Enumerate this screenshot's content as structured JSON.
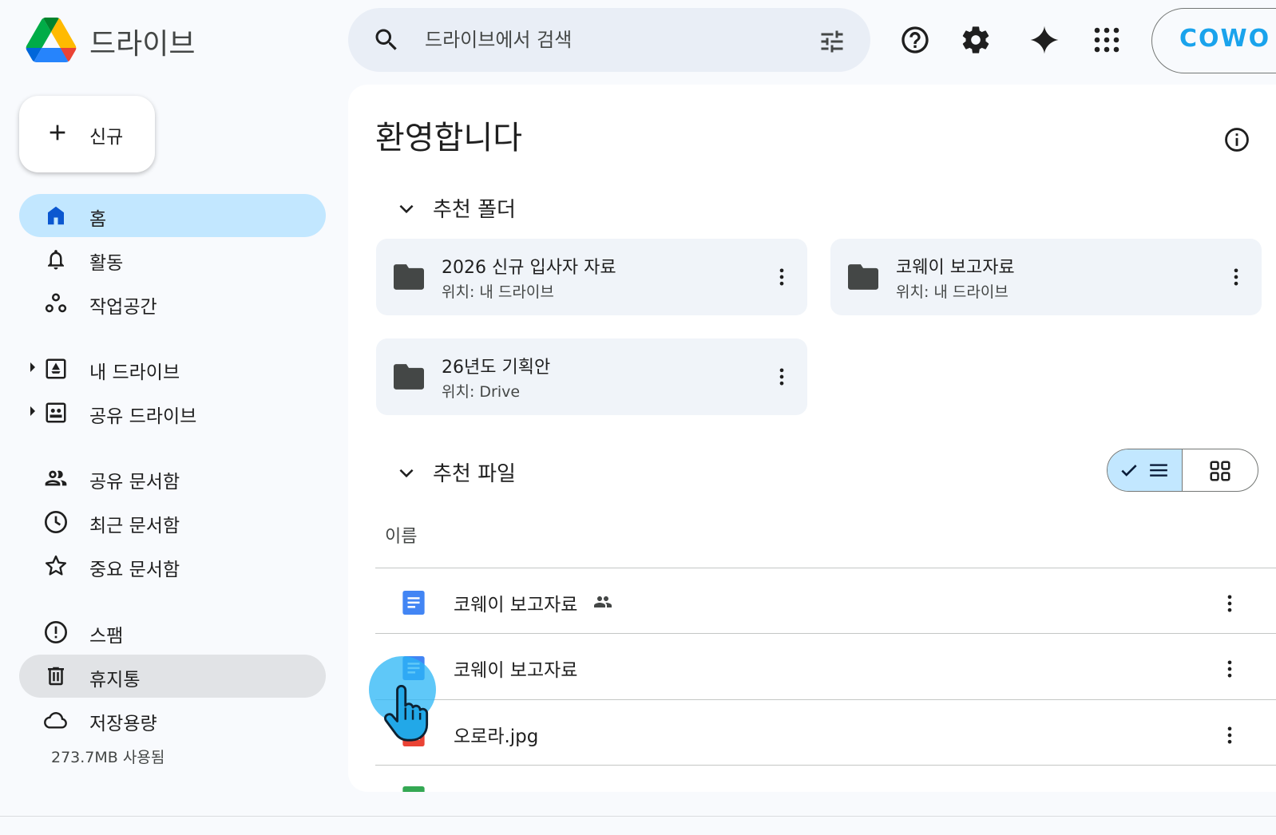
{
  "app": {
    "name": "드라이브"
  },
  "header": {
    "search_placeholder": "드라이브에서 검색",
    "account_label": "COWO"
  },
  "sidebar": {
    "new_button": "신규",
    "items": [
      {
        "label": "홈",
        "icon": "home-icon",
        "state": "active"
      },
      {
        "label": "활동",
        "icon": "bell-icon"
      },
      {
        "label": "작업공간",
        "icon": "workspace-icon"
      },
      {
        "label": "내 드라이브",
        "icon": "my-drive-icon",
        "expandable": true
      },
      {
        "label": "공유 드라이브",
        "icon": "shared-drive-icon",
        "expandable": true
      },
      {
        "label": "공유 문서함",
        "icon": "people-icon"
      },
      {
        "label": "최근 문서함",
        "icon": "clock-icon"
      },
      {
        "label": "중요 문서함",
        "icon": "star-icon"
      },
      {
        "label": "스팸",
        "icon": "spam-icon"
      },
      {
        "label": "휴지통",
        "icon": "trash-icon",
        "state": "hover"
      },
      {
        "label": "저장용량",
        "icon": "cloud-icon"
      }
    ],
    "storage_used": "273.7MB 사용됨"
  },
  "main": {
    "title": "환영합니다",
    "suggested_folders": {
      "title": "추천 폴더",
      "items": [
        {
          "name": "2026 신규 입사자 자료",
          "location": "위치: 내 드라이브"
        },
        {
          "name": "코웨이 보고자료",
          "location": "위치: 내 드라이브"
        },
        {
          "name": "26년도 기획안",
          "location": "위치: Drive"
        }
      ]
    },
    "suggested_files": {
      "title": "추천 파일",
      "column_name": "이름",
      "items": [
        {
          "name": "코웨이 보고자료",
          "type": "doc",
          "shared": true
        },
        {
          "name": "코웨이 보고자료",
          "type": "doc",
          "shared": false
        },
        {
          "name": "오로라.jpg",
          "type": "image",
          "shared": false
        }
      ]
    }
  },
  "colors": {
    "accent": "#c2e7ff",
    "doc_blue": "#4285f4",
    "image_red": "#ea4335",
    "sheet_green": "#34a853",
    "search_bg": "#e9eef6",
    "cursor": "#29b6f6"
  }
}
